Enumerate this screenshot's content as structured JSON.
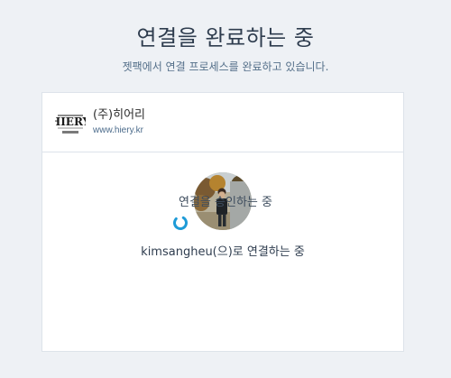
{
  "header": {
    "title": "연결을 완료하는 중",
    "subtitle": "젯팩에서 연결 프로세스를 완료하고 있습니다."
  },
  "card": {
    "org_name": "(주)히어리",
    "org_url": "www.hiery.kr",
    "logo_text": "HIERY",
    "logo_subtext": "주식회사 히어리",
    "connecting_text": "kimsangheu(으)로 연결하는 중",
    "approving_text": "연결을 승인하는 중"
  },
  "colors": {
    "background": "#eef1f5",
    "card": "#ffffff",
    "spinner": "#1e9bd7"
  },
  "icons": {
    "spinner": "loading-spinner-icon",
    "logo": "hiery-logo",
    "avatar": "user-avatar"
  }
}
